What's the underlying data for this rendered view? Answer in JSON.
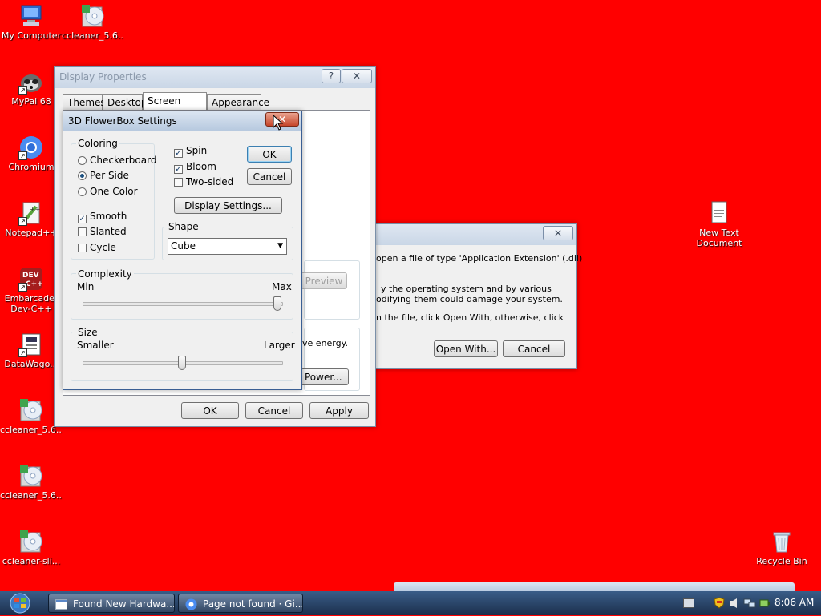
{
  "desktop": {
    "icons": [
      {
        "label": "My Computer"
      },
      {
        "label": "ccleaner_5.6..."
      },
      {
        "label": "MyPal 68"
      },
      {
        "label": "Chromium"
      },
      {
        "label": "Notepad++"
      },
      {
        "label": "Embarcader Dev-C++"
      },
      {
        "label": "DataWago..."
      },
      {
        "label": "ccleaner_5.6..."
      },
      {
        "label": "ccleaner_5.6..."
      },
      {
        "label": "ccleaner-sli..."
      },
      {
        "label": "New Text Document"
      },
      {
        "label": "Recycle Bin"
      }
    ],
    "dev_badge_line1": "DEV",
    "dev_badge_line2": "C++",
    "colors": {
      "background": "#ff0000",
      "accent": "#2f62b5"
    }
  },
  "display_properties": {
    "title": "Display Properties",
    "help_label": "?",
    "close_label": "✕",
    "tabs": [
      {
        "label": "Themes"
      },
      {
        "label": "Desktop"
      },
      {
        "label": "Screen Saver"
      },
      {
        "label": "Appearance"
      }
    ],
    "preview_label": "Preview",
    "energy_text": "ve energy.",
    "power_label": "Power...",
    "ok_label": "OK",
    "cancel_label": "Cancel",
    "apply_label": "Apply"
  },
  "open_with_dialog": {
    "close_label": "✕",
    "line1": "open a file of type 'Application Extension' (.dll)",
    "line2": "y the operating system and by various",
    "line3": "odifying them could damage your system.",
    "line4": "n the file, click Open With, otherwise, click",
    "open_with_label": "Open With...",
    "cancel_label": "Cancel"
  },
  "flowerbox": {
    "title": "3D FlowerBox Settings",
    "close_label": "✕",
    "coloring": {
      "title": "Coloring",
      "checkerboard": "Checkerboard",
      "per_side": "Per Side",
      "one_color": "One Color",
      "smooth": "Smooth",
      "slanted": "Slanted",
      "cycle": "Cycle"
    },
    "spin": "Spin",
    "bloom": "Bloom",
    "two_sided": "Two-sided",
    "display_settings_label": "Display Settings...",
    "shape": {
      "title": "Shape",
      "value": "Cube"
    },
    "complexity": {
      "title": "Complexity",
      "min": "Min",
      "max": "Max",
      "value": 1.0
    },
    "size": {
      "title": "Size",
      "smaller": "Smaller",
      "larger": "Larger",
      "value": 0.5
    },
    "ok_label": "OK",
    "cancel_label": "Cancel"
  },
  "taskbar": {
    "items": [
      {
        "label": "Found New Hardwa..."
      },
      {
        "label": "Page not found · Gi..."
      }
    ],
    "clock": "8:06 AM"
  }
}
